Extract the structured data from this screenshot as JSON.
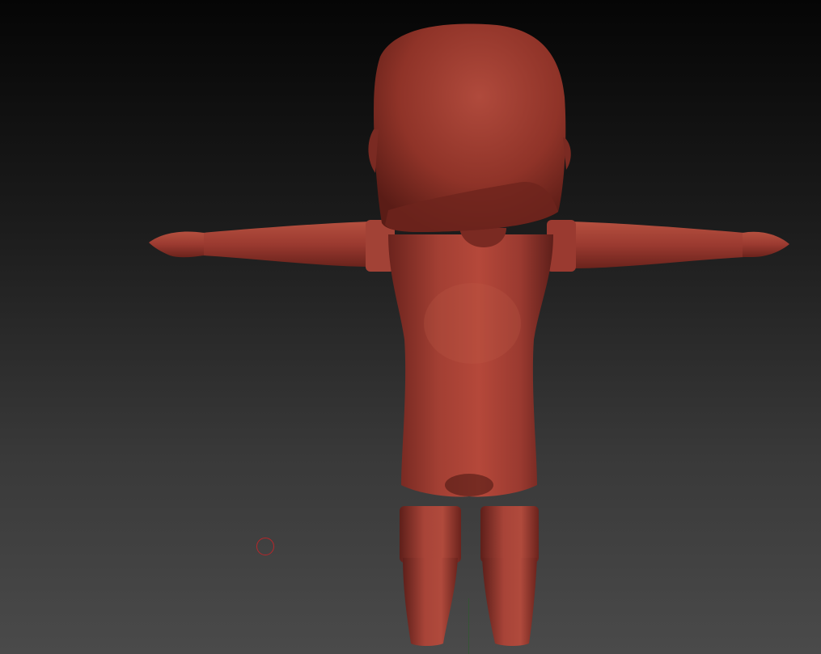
{
  "app": {
    "canvas": {
      "background_top": "#050505",
      "background_bottom": "#4a4a4a",
      "material_color": "#9a3a30",
      "material_shadow": "#5e1f1a",
      "material_highlight": "#c06050",
      "cursor_color": "#b8262a"
    },
    "model": {
      "description_icon": "sculpt-model-icon",
      "pose": "t-pose"
    },
    "cursor": {
      "icon": "brush-cursor-icon"
    }
  }
}
